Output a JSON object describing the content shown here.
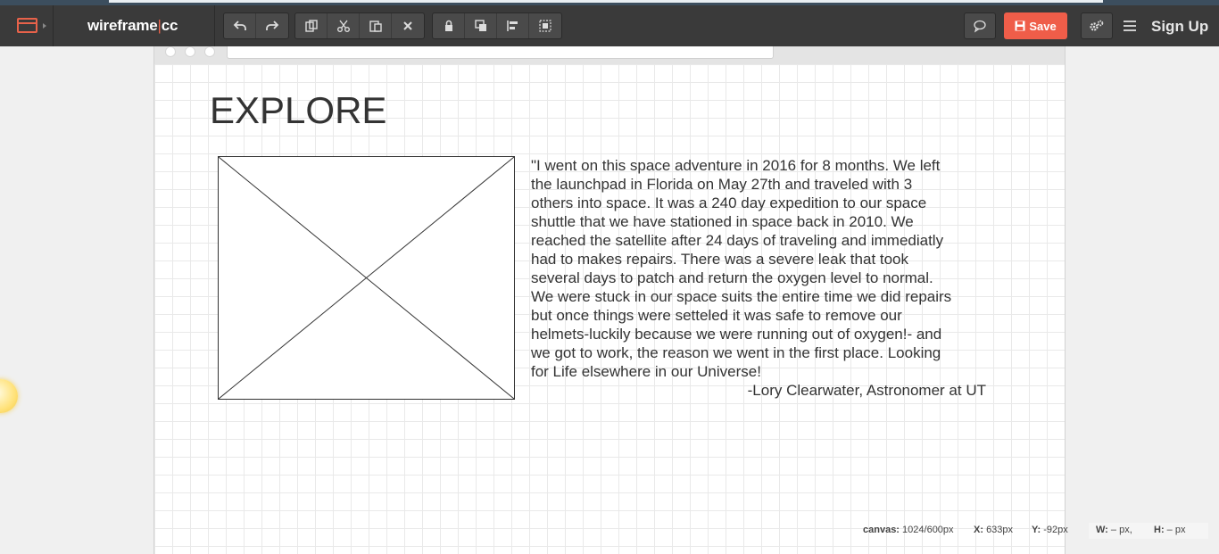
{
  "app": {
    "brand_main": "wireframe",
    "brand_sep": "|",
    "brand_suffix": "cc",
    "save_label": "Save",
    "signup_label": "Sign Up"
  },
  "toolbar": {
    "history": [
      "undo-icon",
      "redo-icon"
    ],
    "edit": [
      "copy-icon",
      "cut-icon",
      "paste-icon",
      "delete-icon"
    ],
    "arrange": [
      "lock-icon",
      "bring-front-icon",
      "align-icon",
      "group-icon"
    ]
  },
  "page": {
    "heading": "EXPLORE",
    "quote_lines": [
      "\"I went on this space adventure in 2016 for 8 months. We left",
      "the launchpad in Florida on May 27th and traveled with 3",
      "others into space. It was a 240 day expedition to our space",
      "shuttle that we have stationed in space back in 2010. We",
      "reached the satellite after 24 days of traveling and immediatly",
      "had to makes repairs. There was a severe leak that took",
      "several days to patch and return the oxygen level to normal.",
      "We were stuck in our space suits the entire time we did repairs",
      "but once things were setteled it was safe to remove our",
      "helmets-luckily because we were running out of oxygen!- and",
      "we got to work, the reason we went in the first place. Looking",
      "for Life elsewhere in our Universe!"
    ],
    "author": "-Lory Clearwater, Astronomer at UT"
  },
  "status": {
    "canvas_label": "canvas:",
    "canvas_value": "1024/600px",
    "x_label": "X:",
    "x_value": "633px",
    "y_label": "Y:",
    "y_value": "-92px",
    "w_label": "W:",
    "w_value": "– px,",
    "h_label": "H:",
    "h_value": "– px"
  },
  "colors": {
    "toolbar_bg": "#3a3a3a",
    "accent": "#ef5d49",
    "text": "#333333"
  }
}
